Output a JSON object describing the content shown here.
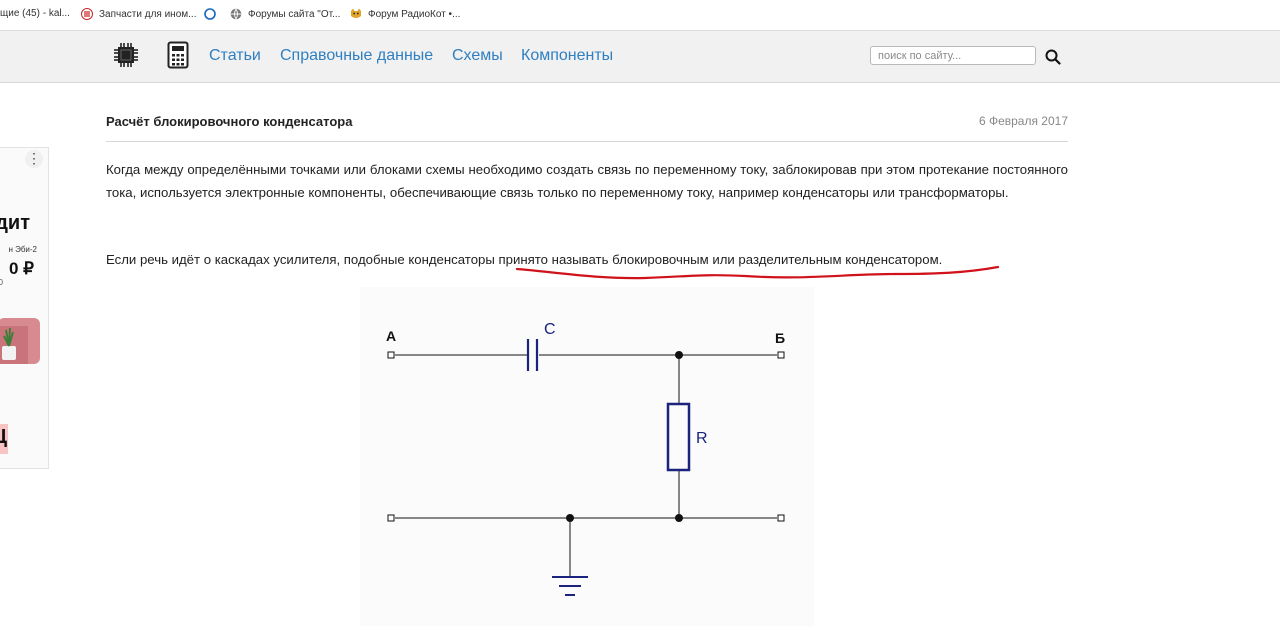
{
  "bookmarks": [
    {
      "label": "щие (45) - kal..."
    },
    {
      "label": "Запчасти для ином..."
    },
    {
      "label": ""
    },
    {
      "label": "Форумы сайта \"От..."
    },
    {
      "label": "Форум РадиоКот •..."
    }
  ],
  "header": {
    "nav": [
      "Статьи",
      "Справочные данные",
      "Схемы",
      "Компоненты"
    ],
    "search_placeholder": "поиск по сайту..."
  },
  "ad": {
    "headline": "дит",
    "subline": "н Эби-2",
    "price": "0 ₽",
    "small": "0",
    "button": "Ц"
  },
  "article": {
    "title": "Расчёт блокировочного конденсатора",
    "date": "6 Февраля 2017",
    "paragraph1": "Когда между определёнными точками или блоками схемы необходимо создать связь по переменному току, заблокировав при этом протекание постоянного тока, используется электронные компоненты, обеспечивающие связь только по переменному току, например конденсаторы или трансформаторы.",
    "paragraph2": "Если речь идёт о каскадах усилителя, подобные конденсаторы принято называть блокировочным или разделительным конденсатором."
  },
  "diagram": {
    "label_a": "А",
    "label_b": "Б",
    "label_c": "C",
    "label_r": "R"
  },
  "colors": {
    "link": "#2f7fc1",
    "circuit_component": "#1a237e",
    "annotation": "#d0121b"
  }
}
